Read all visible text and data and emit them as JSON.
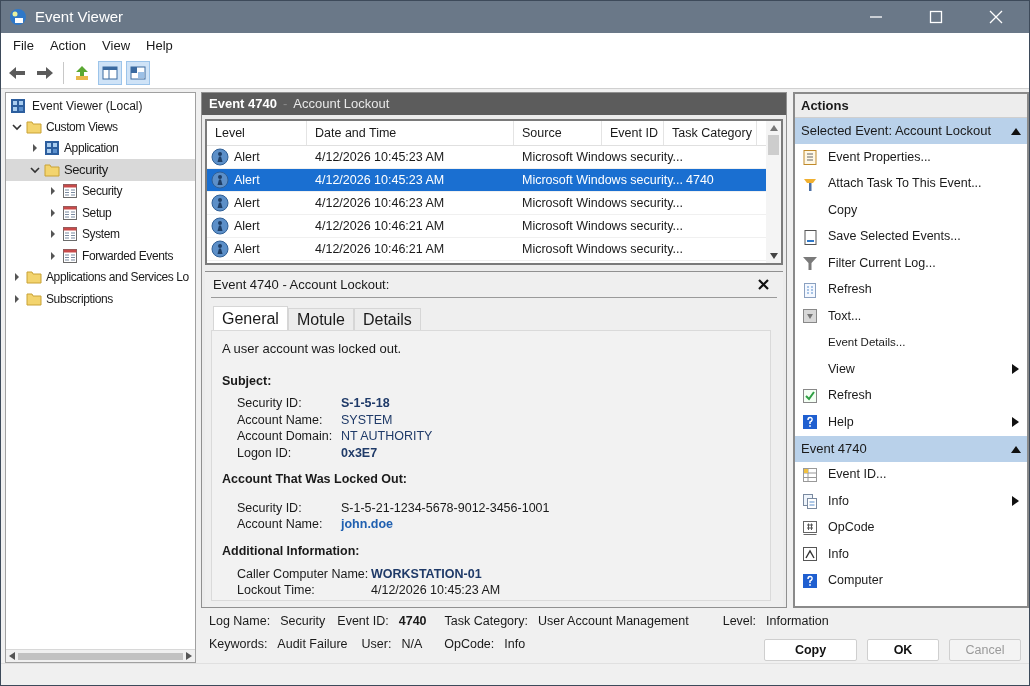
{
  "window": {
    "title": "Event Viewer"
  },
  "menu": [
    "File",
    "Action",
    "View",
    "Help"
  ],
  "toolbar": [
    {
      "kind": "back",
      "pressed": false
    },
    {
      "kind": "forward",
      "pressed": false
    },
    {
      "kind": "up",
      "pressed": false
    },
    {
      "kind": "pane",
      "pressed": true
    },
    {
      "kind": "preview",
      "pressed": true
    }
  ],
  "tree": {
    "root": "Event Viewer (Local)",
    "items": [
      {
        "label": "Custom Views",
        "kind": "folder",
        "expanded": true,
        "selected": false,
        "children": [
          {
            "label": "Application",
            "kind": "view",
            "expanded": false,
            "selected": false
          },
          {
            "label": "Security",
            "kind": "folder",
            "expanded": true,
            "selected": true,
            "children": [
              {
                "label": "Security",
                "kind": "log",
                "expanded": false,
                "selected": false
              },
              {
                "label": "Setup",
                "kind": "log",
                "expanded": false,
                "selected": false
              },
              {
                "label": "System",
                "kind": "log",
                "expanded": false,
                "selected": false
              },
              {
                "label": "Forwarded Events",
                "kind": "log",
                "expanded": false,
                "selected": false
              }
            ]
          }
        ]
      },
      {
        "label": "Applications and Services Lo",
        "kind": "folder",
        "expanded": false,
        "selected": false
      },
      {
        "label": "Subscriptions",
        "kind": "folder",
        "expanded": false,
        "selected": false
      }
    ]
  },
  "events": {
    "title": "Event",
    "event_id": "4740",
    "separator": "-",
    "subtitle": "Account Lockout",
    "columns": [
      "Level",
      "Date and Time",
      "Source",
      "Event ID",
      "Task Category"
    ],
    "rows": [
      {
        "level": "Alert",
        "date": "4/12/2026 10:45:23 AM",
        "source": "Microsoft Windows security...",
        "task_category": "",
        "selected": false
      },
      {
        "level": "Alert",
        "date": "4/12/2026 10:45:23 AM",
        "source": "Microsoft Windows security...",
        "task_category": "4740",
        "selected": true
      },
      {
        "level": "Alert",
        "date": "4/12/2026 10:46:23 AM",
        "source": "Microsoft Windows security...",
        "task_category": "",
        "selected": false
      },
      {
        "level": "Alert",
        "date": "4/12/2026 10:46:21 AM",
        "source": "Microsoft Windows security...",
        "task_category": "",
        "selected": false
      },
      {
        "level": "Alert",
        "date": "4/12/2026 10:46:21 AM",
        "source": "Microsoft Windows security...",
        "task_category": "",
        "selected": false
      }
    ]
  },
  "details": {
    "title": "Event 4740 - Account Lockout:",
    "tabs": [
      {
        "label": "General",
        "selected": true
      },
      {
        "label": "Motule",
        "selected": false
      },
      {
        "label": "Details",
        "selected": false
      }
    ],
    "summary": "A user account was locked out.",
    "sections": [
      {
        "heading": "Subject:",
        "fields": [
          {
            "label": "Security ID:",
            "value": "S-1-5-18",
            "kind": "strong"
          },
          {
            "label": "Account Name:",
            "value": "SYSTEM",
            "kind": "highlight"
          },
          {
            "label": "Account Domain:",
            "value": "NT AUTHORITY",
            "kind": "highlight"
          },
          {
            "label": "Logon ID:",
            "value": "0x3E7",
            "kind": "strong"
          }
        ]
      },
      {
        "heading": "Account That Was Locked Out:",
        "fields": [
          {
            "label": "Security ID:",
            "value": "S-1-5-21-1234-5678-9012-3456-1001",
            "kind": "plain"
          },
          {
            "label": "Account Name:",
            "value": "john.doe",
            "kind": "link"
          }
        ]
      },
      {
        "heading": "Additional Information:",
        "fields": [
          {
            "label": "Caller Computer Name:",
            "value": "WORKSTATION-01",
            "kind": "strong"
          },
          {
            "label": "Lockout Time:",
            "value": "4/12/2026 10:45:23 AM",
            "kind": "plain"
          }
        ]
      }
    ]
  },
  "info_rows": [
    [
      {
        "label": "Log Name:",
        "value": "Security",
        "bold": false
      },
      {
        "label": "Event ID:",
        "value": "4740",
        "bold": true
      },
      {
        "label": "Task Category:",
        "value": "User  Account Management",
        "bold": false
      },
      {
        "label": "Level:",
        "value": "Information",
        "bold": false
      }
    ],
    [
      {
        "label": "Keywords:",
        "value": "Audit Failure",
        "bold": false
      },
      {
        "label": "User:",
        "value": "N/A",
        "bold": false
      },
      {
        "label": "OpCode:",
        "value": "Info",
        "bold": false
      }
    ]
  ],
  "buttons": [
    {
      "label": "Copy",
      "disabled": false
    },
    {
      "label": "OK",
      "disabled": false
    },
    {
      "label": "Cancel",
      "disabled": true
    }
  ],
  "actions": {
    "title": "Actions",
    "sections": [
      {
        "title": "Selected Event: Account Lockout",
        "expanded": true,
        "items": [
          {
            "label": "Event Properties...",
            "kind": "properties",
            "submenu": false
          },
          {
            "label": "Attach Task To This Event...",
            "kind": "task",
            "submenu": false
          },
          {
            "label": "Copy",
            "kind": "none",
            "submenu": false
          },
          {
            "label": "Save Selected Events...",
            "kind": "save",
            "submenu": false
          },
          {
            "label": "Filter Current Log...",
            "kind": "filter",
            "submenu": false
          },
          {
            "label": "Refresh",
            "kind": "refresh",
            "submenu": false
          },
          {
            "label": "Toxt...",
            "kind": "text",
            "submenu": false
          },
          {
            "label": "Event Details...",
            "kind": "none",
            "submenu": false
          },
          {
            "label": "View",
            "kind": "none",
            "submenu": true
          },
          {
            "label": "Refresh",
            "kind": "check",
            "submenu": false
          },
          {
            "label": "Help",
            "kind": "help",
            "submenu": true
          }
        ]
      },
      {
        "title": "Event 4740",
        "expanded": true,
        "items": [
          {
            "label": "Event ID...",
            "kind": "grid",
            "submenu": false
          },
          {
            "label": "Info",
            "kind": "info",
            "submenu": true
          },
          {
            "label": "OpCode",
            "kind": "opcode",
            "submenu": false
          },
          {
            "label": "Info",
            "kind": "image",
            "submenu": false
          },
          {
            "label": "Computer",
            "kind": "help",
            "submenu": false
          }
        ]
      }
    ]
  }
}
